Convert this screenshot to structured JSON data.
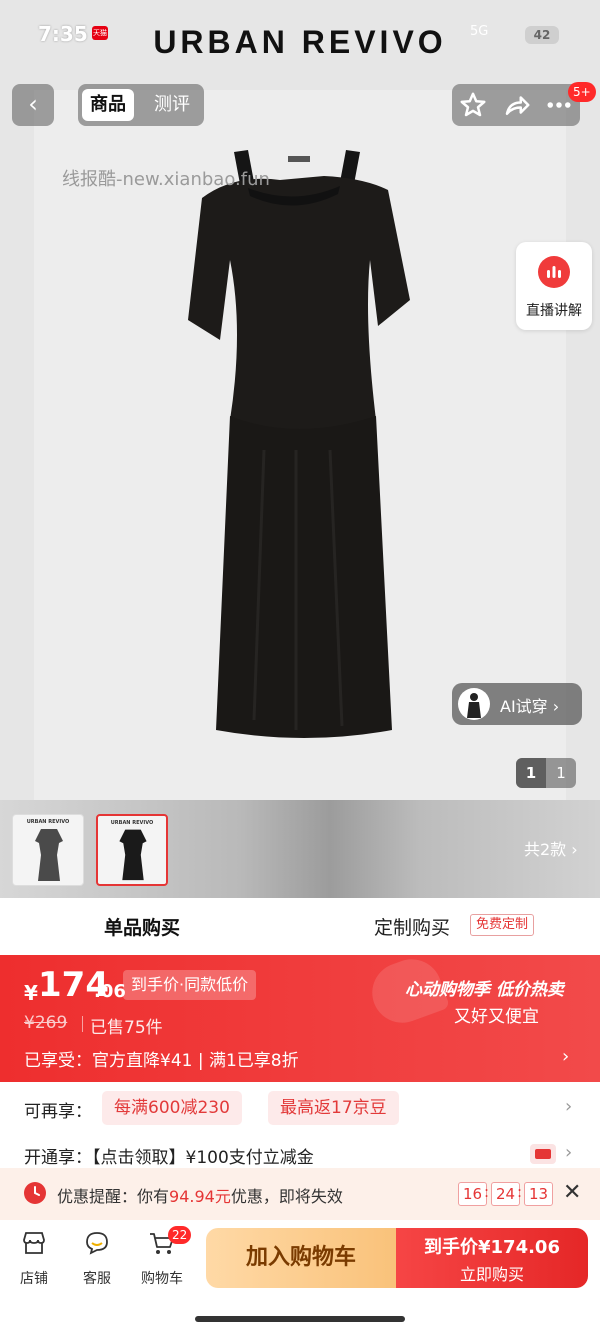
{
  "status_bar": {
    "time": "7:35",
    "app_badge": "天猫",
    "signal": "5G",
    "battery": "42"
  },
  "brand": "URBAN REVIVO",
  "nav": {
    "back_glyph": "‹",
    "tabs": [
      {
        "label": "商品"
      },
      {
        "label": "测评"
      }
    ],
    "notifications": "5+"
  },
  "watermark": "线报酷-new.xianbao.fun",
  "live": {
    "label": "直播讲解"
  },
  "ai_try": {
    "label": "AI试穿 ›"
  },
  "pager": {
    "current": "1",
    "total": "1"
  },
  "variants": {
    "thumb_brand": "URBAN REVIVO",
    "count_label": "共2款 ›"
  },
  "purchase_tabs": {
    "single": "单品购买",
    "custom": "定制购买",
    "custom_badge": "免费定制"
  },
  "price": {
    "yen": "¥",
    "integer": "174",
    "decimal": ".06",
    "tag": "到手价·同款低价",
    "original": "¥269",
    "sold": "已售75件",
    "enjoyed": "已享受：官方直降¥41 | 满1已享8折",
    "promo_title": "心动购物季 低价热卖",
    "promo_sub": "又好又便宜"
  },
  "benefits": {
    "label": "可再享：",
    "chips": [
      "每满600减230",
      "最高返17京豆"
    ]
  },
  "membership": {
    "text": "开通享：【点击领取】¥100支付立减金"
  },
  "reminder": {
    "prefix": "优惠提醒：你有",
    "amount": "94.94元",
    "suffix": "优惠，即将失效",
    "hh": "16",
    "mm": "24",
    "ss": "13",
    "close_glyph": "✕"
  },
  "bottom_bar": {
    "store": "店铺",
    "service": "客服",
    "cart": "购物车",
    "cart_count": "22",
    "add_to_cart": "加入购物车",
    "buy_price": "到手价¥174.06",
    "buy_label": "立即购买"
  },
  "colors": {
    "accent": "#e53535",
    "cart_button": "#f9c27a",
    "buy_button": "#e52727"
  }
}
